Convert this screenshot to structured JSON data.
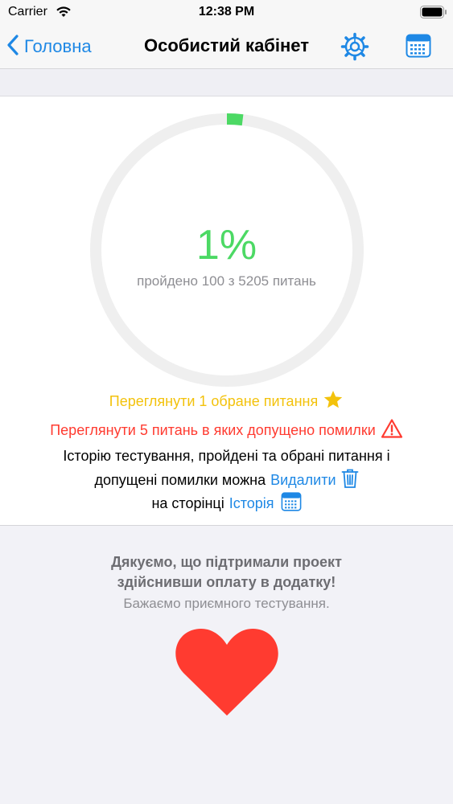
{
  "status_bar": {
    "carrier": "Carrier",
    "time": "12:38 PM"
  },
  "nav": {
    "back_label": "Головна",
    "title": "Особистий кабінет",
    "icons": [
      "chevron-left-icon",
      "settings-gear-icon",
      "calendar-icon"
    ]
  },
  "progress": {
    "percent_label": "1%",
    "fraction": 0.0192,
    "summary": "пройдено 100 з 5205 питань"
  },
  "links": {
    "favorites": "Переглянути 1 обране питання",
    "errors": "Переглянути 5 питань в яких допущено помилки"
  },
  "info": {
    "line1": "Історію тестування, пройдені та обрані питання і",
    "line2": "допущені помилки можна",
    "delete_link": "Видалити",
    "line3": "на сторінці",
    "history_link": "Історія"
  },
  "thanks": {
    "line1": "Дякуємо, що підтримали проект",
    "line2": "здійснивши оплату в додатку!",
    "line3": "Бажаємо приємного тестування."
  },
  "colors": {
    "accent": "#1e88e5",
    "success": "#4cd964",
    "warning": "#f3c20c",
    "error": "#ff3b30",
    "heart": "#ff3b30"
  }
}
